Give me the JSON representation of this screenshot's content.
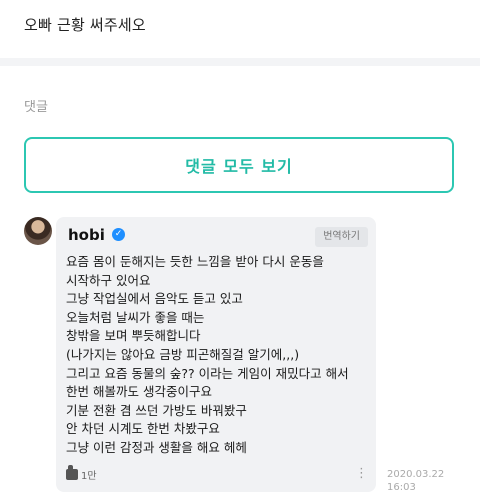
{
  "post": {
    "title": "오빠 근황 써주세오"
  },
  "comments_section": {
    "heading": "댓글",
    "view_all_label": "댓글 모두 보기"
  },
  "comment": {
    "author": "hobi",
    "verified_icon": "verified-badge-icon",
    "translate_label": "번역하기",
    "lines": [
      "요즘 몸이 둔해지는 듯한 느낌을 받아 다시 운동을",
      "시작하구 있어요",
      "그냥 작업실에서 음악도 듣고 있고",
      "오늘처럼 날씨가 좋을 때는",
      "창밖을 보며 뿌듯해합니다",
      "(나가지는 않아요 금방 피곤해질걸 알기에,,,)",
      "그리고 요즘 동물의 숲?? 이라는 게임이 재밌다고 해서",
      "한번 해볼까도 생각중이구요",
      "기분 전환 겸 쓰던 가방도 바꿔봤구",
      "안 차던 시계도 한번 차봤구요",
      "그냥 이런 감정과 생활을 해요 헤헤"
    ],
    "likes": "1만",
    "date": "2020.03.22",
    "time": "16:03"
  },
  "colors": {
    "accent": "#2cc7b2",
    "bubble_bg": "#f1f2f4",
    "verified": "#1f8fff"
  }
}
